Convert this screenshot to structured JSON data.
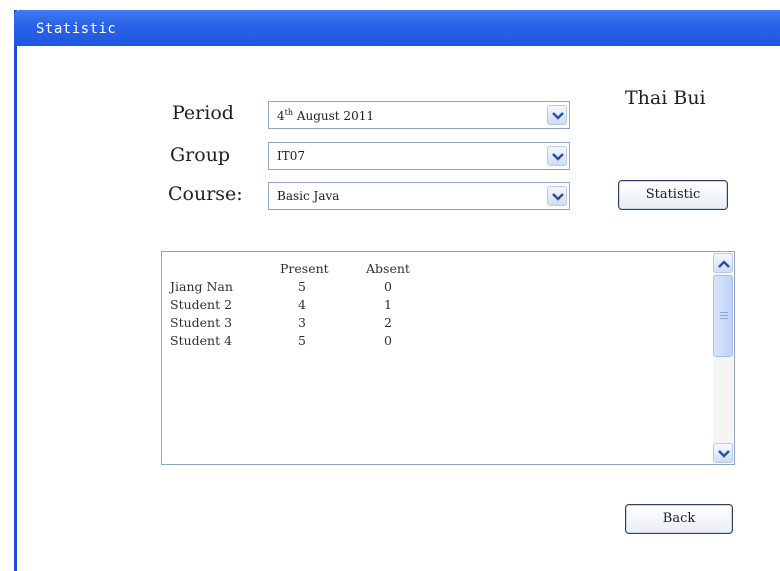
{
  "window": {
    "title": "Statistic"
  },
  "user": {
    "name": "Thai Bui"
  },
  "form": {
    "period": {
      "label": "Period",
      "value_prefix": "4",
      "value_sup": "th",
      "value_suffix": " August 2011"
    },
    "group": {
      "label": "Group",
      "value": "IT07"
    },
    "course": {
      "label": "Course:",
      "value": "Basic Java"
    }
  },
  "buttons": {
    "statistic": "Statistic",
    "back": "Back"
  },
  "table": {
    "columns": [
      "Present",
      "Absent"
    ],
    "rows": [
      {
        "name": "Jiang Nan",
        "present": "5",
        "absent": "0"
      },
      {
        "name": "Student 2",
        "present": "4",
        "absent": "1"
      },
      {
        "name": "Student 3",
        "present": "3",
        "absent": "2"
      },
      {
        "name": "Student 4",
        "present": "5",
        "absent": "0"
      }
    ]
  },
  "colors": {
    "titlebar": "#2a64e8",
    "accent": "#1c4fd6"
  },
  "icons": {
    "dropdown": "chevron-down-icon",
    "scroll_up": "chevron-up-icon",
    "scroll_down": "chevron-down-icon"
  }
}
